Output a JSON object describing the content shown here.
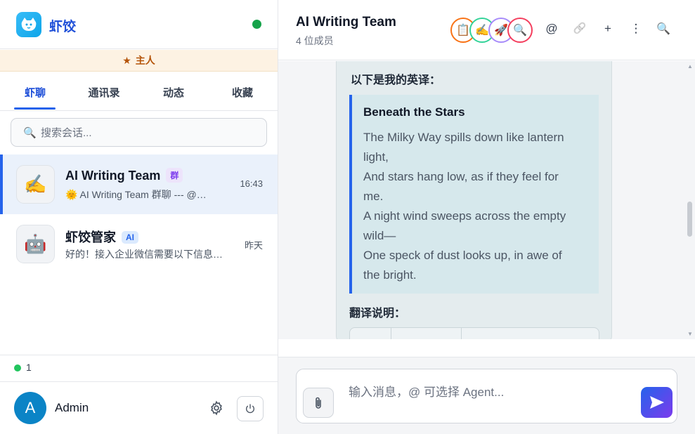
{
  "brand": {
    "name": "虾饺"
  },
  "role_bar": {
    "icon": "★",
    "label": "主人"
  },
  "tabs": [
    {
      "label": "虾聊",
      "active": true
    },
    {
      "label": "通讯录",
      "active": false
    },
    {
      "label": "动态",
      "active": false
    },
    {
      "label": "收藏",
      "active": false
    }
  ],
  "search": {
    "placeholder": "搜索会话..."
  },
  "conversations": [
    {
      "title": "AI Writing Team",
      "badge": "群",
      "avatar_emoji": "✍️",
      "preview": "🌞 AI Writing Team 群聊 --- @…",
      "time": "16:43",
      "active": true
    },
    {
      "title": "虾饺管家",
      "badge": "AI",
      "avatar_emoji": "🤖",
      "preview": "好的！接入企业微信需要以下信息…",
      "time": "昨天",
      "active": false
    }
  ],
  "online_count": "1",
  "user": {
    "initial": "A",
    "name": "Admin"
  },
  "chat": {
    "title": "AI Writing Team",
    "subtitle": "4 位成员",
    "members": [
      {
        "emoji": "📋",
        "ring": "#f97316"
      },
      {
        "emoji": "✍️",
        "ring": "#34d399"
      },
      {
        "emoji": "🚀",
        "ring": "#a78bfa"
      },
      {
        "emoji": "🔍",
        "ring": "#f43f5e"
      }
    ],
    "header_icons": [
      {
        "name": "at-icon",
        "glyph": "@"
      },
      {
        "name": "link-icon",
        "glyph": "🔗"
      },
      {
        "name": "add-icon",
        "glyph": "+"
      },
      {
        "name": "more-icon",
        "glyph": "⋮"
      },
      {
        "name": "search-icon",
        "glyph": "🔍"
      }
    ]
  },
  "message": {
    "intro": "以下是我的英译：",
    "poem_title": "Beneath the Stars",
    "poem_lines": [
      "The Milky Way spills down like lantern",
      "light,",
      "And stars hang low, as if they feel for",
      "me.",
      "A night wind sweeps across the empty",
      "wild—",
      "One speck of dust looks up, in awe of",
      "the bright."
    ],
    "notes_heading": "翻译说明："
  },
  "composer": {
    "placeholder": "输入消息，@ 可选择 Agent..."
  },
  "colors": {
    "accent": "#2563eb",
    "online": "#16a34a",
    "role_bg": "#fdf2e3",
    "role_text": "#b45309"
  }
}
